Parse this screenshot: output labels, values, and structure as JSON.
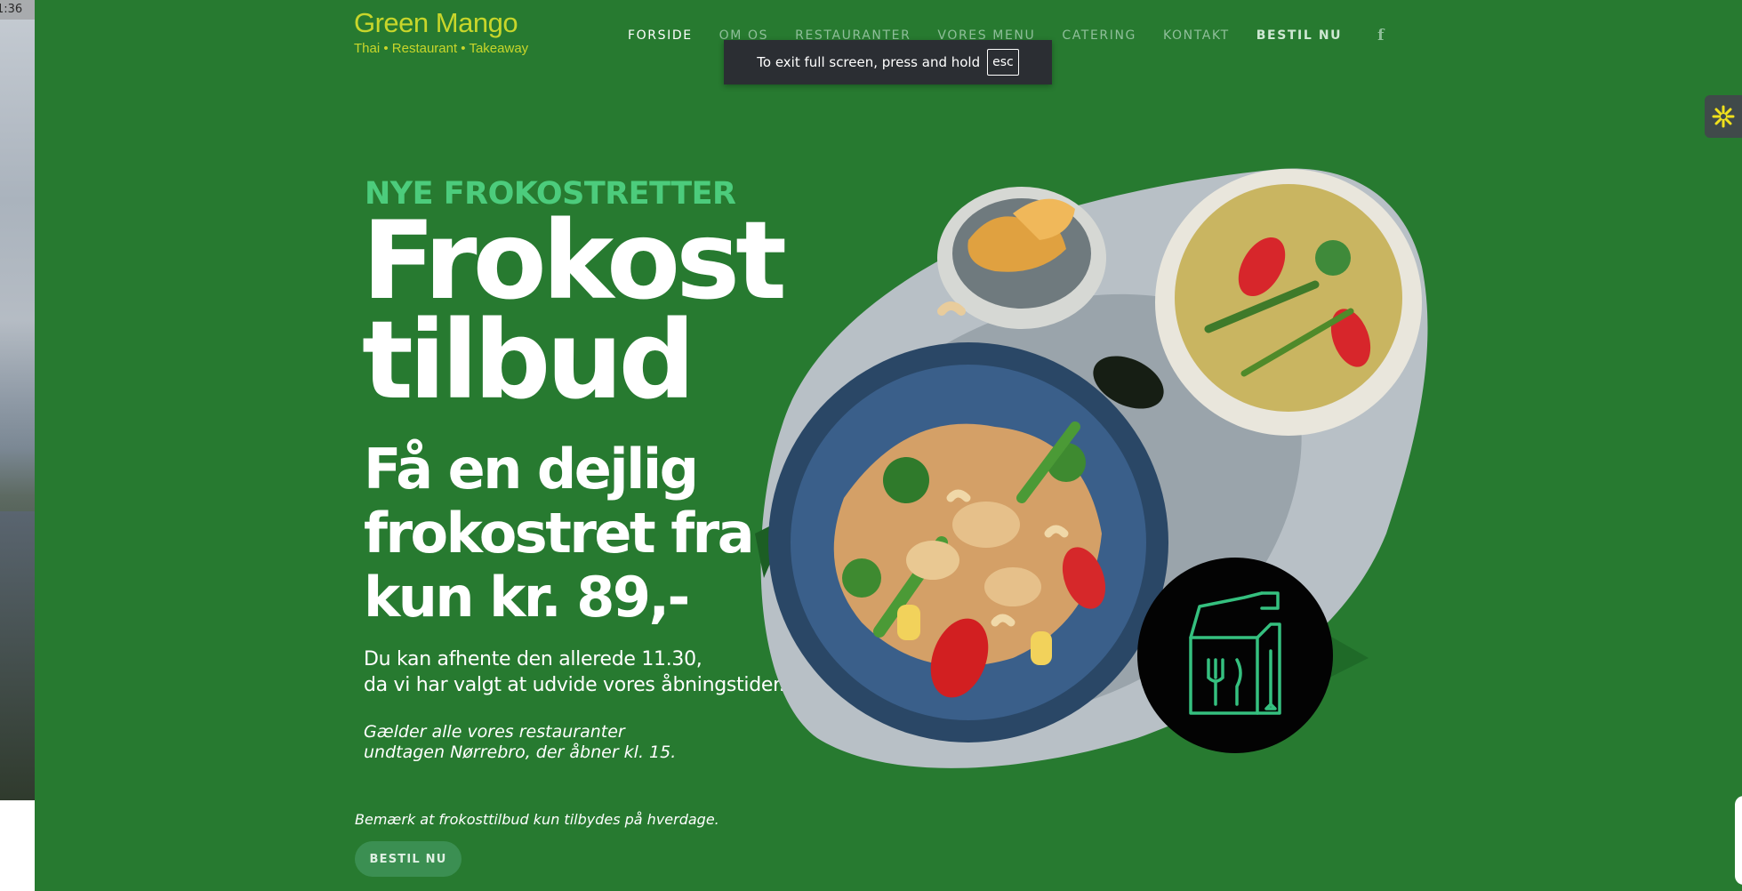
{
  "desktop": {
    "clock": "1:36"
  },
  "header": {
    "logo_name": "Green Mango",
    "logo_tagline": "Thai • Restaurant • Takeaway",
    "nav": [
      {
        "label": "FORSIDE",
        "active": true
      },
      {
        "label": "OM OS",
        "active": false
      },
      {
        "label": "RESTAURANTER",
        "active": false
      },
      {
        "label": "VORES MENU",
        "active": false
      },
      {
        "label": "CATERING",
        "active": false
      },
      {
        "label": "KONTAKT",
        "active": false
      },
      {
        "label": "BESTIL NU",
        "active": false
      }
    ],
    "facebook_icon": "f"
  },
  "fullscreen_notice": {
    "text": "To exit full screen, press and hold",
    "key": "esc"
  },
  "hero": {
    "eyebrow": "NYE FROKOSTRETTER",
    "headline_line1": "Frokost",
    "headline_line2": "tilbud",
    "offer_line1": "Få en dejlig",
    "offer_line2": "frokostret fra",
    "offer_line3": "kun kr. 89,-",
    "pickup_line1": "Du kan afhente den allerede 11.30,",
    "pickup_line2": "da vi har valgt at udvide vores åbningstider.",
    "valid_line1": "Gælder alle vores restauranter",
    "valid_line2": "undtagen Nørrebro, der åbner kl. 15.",
    "note": "Bemærk at frokosttilbud kun tilbydes på hverdage.",
    "cta": "BESTIL NU"
  },
  "icons": {
    "side_widget": "sunburst-icon",
    "badge": "takeaway-bag-icon"
  },
  "colors": {
    "page_bg": "#277a30",
    "logo": "#c8d62b",
    "eyebrow": "#4ccc7c",
    "badge_line": "#35c07f"
  }
}
